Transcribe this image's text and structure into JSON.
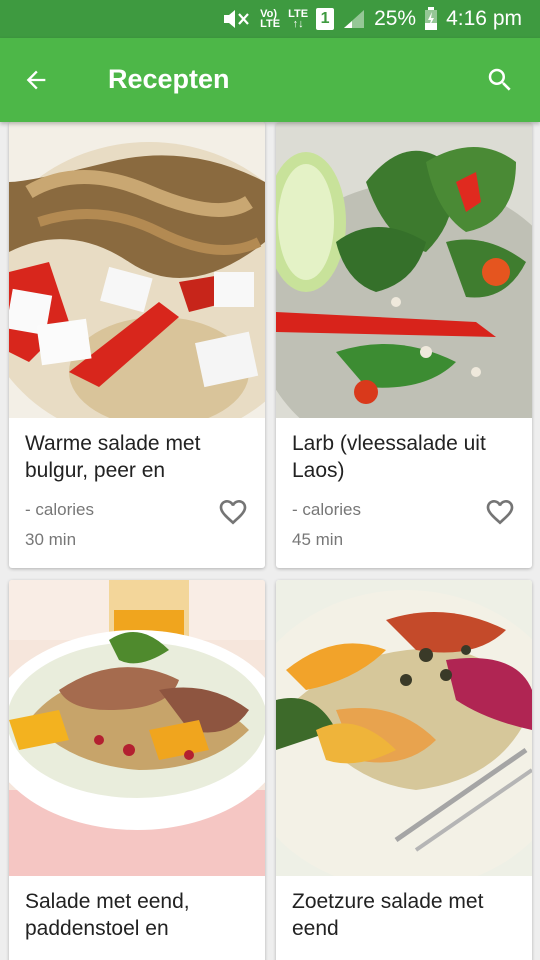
{
  "status_bar": {
    "volte_top": "Vo)",
    "volte_bottom": "LTE",
    "lte_label": "LTE",
    "sim_number": "1",
    "battery": "25%",
    "time": "4:16 pm"
  },
  "app_bar": {
    "title": "Recepten"
  },
  "recipes": [
    {
      "title": "Warme salade met bulgur, peer en",
      "calories": "- calories",
      "time": "30 min"
    },
    {
      "title": "Larb (vleessalade uit Laos)",
      "calories": "- calories",
      "time": "45 min"
    },
    {
      "title": "Salade met eend, paddenstoel en"
    },
    {
      "title": "Zoetzure salade met eend"
    }
  ],
  "colors": {
    "status_bar": "#3e9a40",
    "app_bar": "#4db748"
  }
}
